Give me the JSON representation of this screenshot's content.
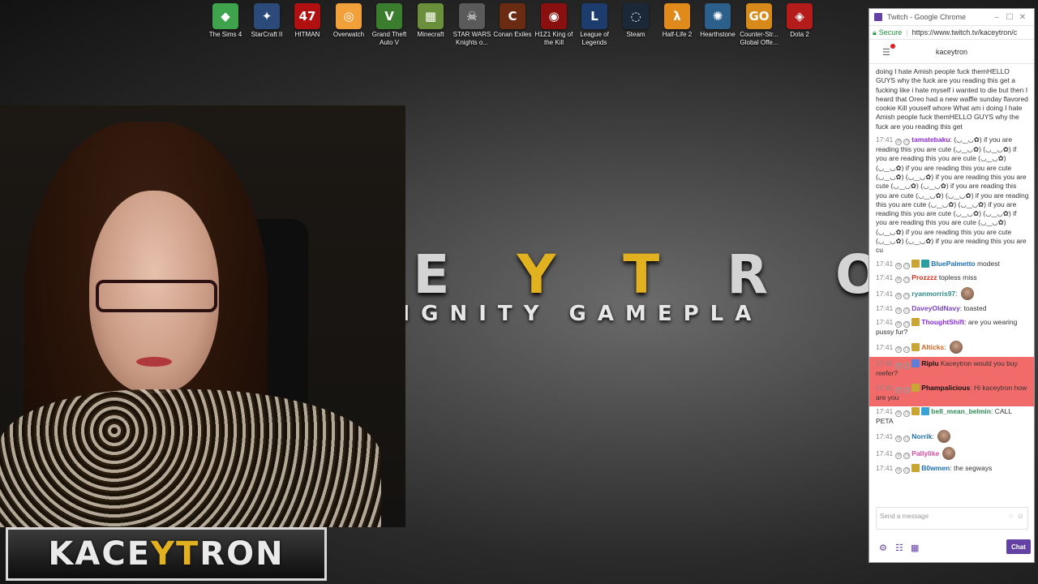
{
  "desktop": {
    "icons": [
      {
        "label": "The Sims 4",
        "color": "#3fa34d",
        "glyph": "◆"
      },
      {
        "label": "StarCraft II",
        "color": "#2b4a7a",
        "glyph": "✦"
      },
      {
        "label": "HITMAN",
        "color": "#b01010",
        "glyph": "47"
      },
      {
        "label": "Overwatch",
        "color": "#f2a13a",
        "glyph": "◎"
      },
      {
        "label": "Grand Theft Auto V",
        "color": "#3b7d2e",
        "glyph": "V"
      },
      {
        "label": "Minecraft",
        "color": "#6a8f3a",
        "glyph": "▦"
      },
      {
        "label": "STAR WARS Knights o...",
        "color": "#5a5a5a",
        "glyph": "☠"
      },
      {
        "label": "Conan Exiles",
        "color": "#6b2a12",
        "glyph": "C"
      },
      {
        "label": "H1Z1 King of the Kill",
        "color": "#8a1010",
        "glyph": "◉"
      },
      {
        "label": "League of Legends",
        "color": "#1d3c6e",
        "glyph": "L"
      },
      {
        "label": "Steam",
        "color": "#1b2838",
        "glyph": "◌"
      },
      {
        "label": "Half-Life 2",
        "color": "#e08a1c",
        "glyph": "λ"
      },
      {
        "label": "Hearthstone",
        "color": "#2c5f8a",
        "glyph": "✺"
      },
      {
        "label": "Counter-Str... Global Offe...",
        "color": "#d78a1a",
        "glyph": "GO"
      },
      {
        "label": "Dota 2",
        "color": "#b41b1b",
        "glyph": "◈"
      }
    ]
  },
  "wallpaper": {
    "brand_pre": "C E ",
    "brand_gold": "Y T",
    "brand_post": " R O",
    "tagline": "CT DIGNITY GAMEPLA"
  },
  "logo": {
    "pre": "KACE",
    "gold": "YT",
    "post": "RON"
  },
  "window": {
    "title": "Twitch - Google Chrome",
    "secure_label": "Secure",
    "url": "https://www.twitch.tv/kaceytron/c"
  },
  "chat": {
    "channel": "kaceytron",
    "input_placeholder": "Send a message",
    "send_label": "Chat",
    "spam_text": "doing I hate Amish people fuck themHELLO GUYS why the fuck are you reading this get a fucking like i hate myself i wanted to die but then I heard that Oreo had a new waffle sunday flavored cookie Kill youself whore What am i doing I hate Amish people fuck themHELLO GUYS why the fuck are you reading this get",
    "messages": [
      {
        "time": "17:41",
        "badge": "",
        "user": "tamatebaku",
        "color": "#8a2be2",
        "text": " (◡‿◡✿) if you are reading this you are cute (◡‿◡✿) (◡‿◡✿) if you are reading this you are cute (◡‿◡✿) (◡‿◡✿) if you are reading this you are cute (◡‿◡✿) (◡‿◡✿) if you are reading this you are cute (◡‿◡✿) (◡‿◡✿) if you are reading this you are cute (◡‿◡✿) (◡‿◡✿) if you are reading this you are cute (◡‿◡✿) (◡‿◡✿) if you are reading this you are cute (◡‿◡✿) (◡‿◡✿) if you are reading this you are cute (◡‿◡✿) (◡‿◡✿) if you are reading this you are cute (◡‿◡✿) (◡‿◡✿) if you are reading this you are cu",
        "colon": ":",
        "emote": false,
        "hl": false
      },
      {
        "time": "17:41",
        "badge": "gold teal",
        "user": "BluePalmetto",
        "color": "#1e6fb8",
        "text": " modest",
        "colon": "",
        "emote": false,
        "hl": false
      },
      {
        "time": "17:41",
        "badge": "",
        "user": "Prozzzz",
        "color": "#d8311c",
        "text": " topless miss",
        "colon": "",
        "emote": false,
        "hl": false
      },
      {
        "time": "17:41",
        "badge": "",
        "user": "ryanmorris97",
        "color": "#2e8b8b",
        "text": "",
        "colon": ":",
        "emote": true,
        "hl": false
      },
      {
        "time": "17:41",
        "badge": "",
        "user": "DaveyOldNavy",
        "color": "#7a44c2",
        "text": " toasted",
        "colon": ":",
        "emote": false,
        "hl": false
      },
      {
        "time": "17:41",
        "badge": "gold",
        "user": "ThoughtShift",
        "color": "#8a2be2",
        "text": " are you wearing pussy fur?",
        "colon": ":",
        "emote": false,
        "hl": false
      },
      {
        "time": "17:41",
        "badge": "gold",
        "user": "Alticks",
        "color": "#d8621c",
        "text": "",
        "colon": ":",
        "emote": true,
        "hl": false
      },
      {
        "time": "17:41",
        "badge": "sub",
        "user": "Riplu",
        "color": "#111111",
        "text": " Kaceytron would you buy reefer?",
        "colon": "",
        "emote": false,
        "hl": true
      },
      {
        "time": "17:41",
        "badge": "gold",
        "user": "Phampalicious",
        "color": "#111111",
        "text": " Hi kaceytron how are you",
        "colon": ":",
        "emote": false,
        "hl": true
      },
      {
        "time": "17:41",
        "badge": "gold blue",
        "user": "bell_mean_belmin",
        "color": "#2e8b57",
        "text": " CALL PETA",
        "colon": ":",
        "emote": false,
        "hl": false
      },
      {
        "time": "17:41",
        "badge": "",
        "user": "Norrik",
        "color": "#1e6fb8",
        "text": "",
        "colon": ":",
        "emote": true,
        "hl": false
      },
      {
        "time": "17:41",
        "badge": "",
        "user": "Pallylike",
        "color": "#d84ba0",
        "text": "",
        "colon": "",
        "emote": true,
        "hl": false
      },
      {
        "time": "17:41",
        "badge": "gold",
        "user": "B0wmen",
        "color": "#1e6fb8",
        "text": " the segways",
        "colon": ":",
        "emote": false,
        "hl": false
      }
    ]
  }
}
